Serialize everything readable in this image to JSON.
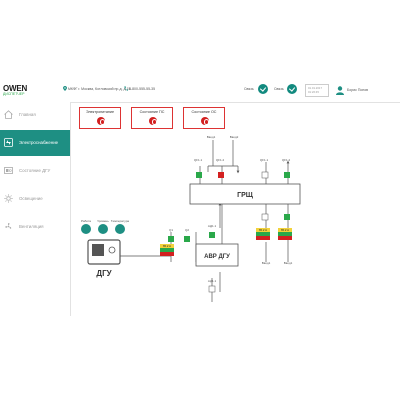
{
  "header": {
    "logo_text": "OWEN",
    "logo_sub": "ДИСПЕТЧЕР",
    "address": "МКФГ г. Москва, Котловский пр-д, д.15",
    "phone": "8-800-555-55-35",
    "status1_label": "Связь",
    "status2_label": "Связь",
    "date": "01.01.2017",
    "time": "01:26:45",
    "user_name": "Борис Попов"
  },
  "sidebar": {
    "items": [
      {
        "label": "Главная"
      },
      {
        "label": "Электроснабжение"
      },
      {
        "label": "Состояние ДГУ"
      },
      {
        "label": "Освещение"
      },
      {
        "label": "Вентиляция"
      }
    ]
  },
  "cards": [
    {
      "title": "Электропитание"
    },
    {
      "title": "Состояние ПС"
    },
    {
      "title": "Состояние ОС"
    }
  ],
  "diagram": {
    "top_inputs": [
      "Ввод1",
      "Ввод2"
    ],
    "grsch_label": "ГРЩ",
    "avr_label": "АВР ДГУ",
    "dgu_label": "ДГУ",
    "indicators": [
      "Работа",
      "Уровень",
      "Температура"
    ],
    "qf_labels": [
      "QF1.1",
      "QF1.2",
      "QF1.1",
      "QF1.2",
      "QF1.1",
      "QF1.2",
      "Q1",
      "Q2",
      "АД1.1",
      "АД1.1"
    ],
    "bottom_labels": [
      "Ввод1",
      "Ввод1"
    ],
    "current_values": [
      "65.2 А",
      "65.2 А",
      "65.2 А"
    ],
    "colors": {
      "on": "#2aa84a",
      "off": "#d32020",
      "neutral": "#ffffff",
      "warn": "#f2d23a"
    }
  }
}
